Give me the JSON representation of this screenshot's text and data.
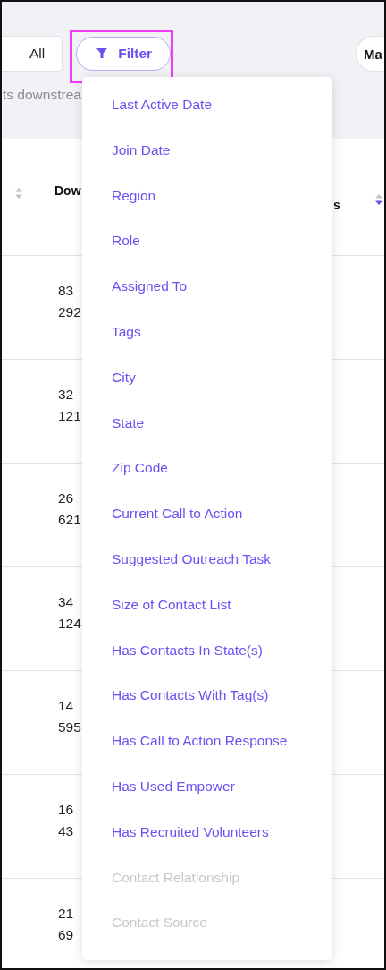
{
  "toolbar": {
    "segments": [
      {
        "label": "All"
      }
    ],
    "filter_button": {
      "label": "Filter",
      "highlighted": true
    },
    "right_button": {
      "label": "Ma"
    }
  },
  "subtitle": "ts downstrea",
  "table": {
    "columns": [
      {
        "sorted_descending": false
      },
      {
        "label": "Dow"
      },
      {
        "label": "s",
        "sorted_descending": true
      }
    ],
    "rows": [
      {
        "lines": [
          "83",
          "292"
        ]
      },
      {
        "lines": [
          "32",
          "121"
        ]
      },
      {
        "lines": [
          "26",
          "621"
        ]
      },
      {
        "lines": [
          "34",
          "124"
        ]
      },
      {
        "lines": [
          "14",
          "595"
        ]
      },
      {
        "lines": [
          "16",
          "43"
        ]
      },
      {
        "lines": [
          "21",
          "69"
        ]
      }
    ]
  },
  "filter_menu": {
    "items": [
      {
        "label": "Last Active Date",
        "disabled": false
      },
      {
        "label": "Join Date",
        "disabled": false
      },
      {
        "label": "Region",
        "disabled": false
      },
      {
        "label": "Role",
        "disabled": false
      },
      {
        "label": "Assigned To",
        "disabled": false
      },
      {
        "label": "Tags",
        "disabled": false
      },
      {
        "label": "City",
        "disabled": false
      },
      {
        "label": "State",
        "disabled": false
      },
      {
        "label": "Zip Code",
        "disabled": false
      },
      {
        "label": "Current Call to Action",
        "disabled": false
      },
      {
        "label": "Suggested Outreach Task",
        "disabled": false
      },
      {
        "label": "Size of Contact List",
        "disabled": false
      },
      {
        "label": "Has Contacts In State(s)",
        "disabled": false
      },
      {
        "label": "Has Contacts With Tag(s)",
        "disabled": false
      },
      {
        "label": "Has Call to Action Response",
        "disabled": false
      },
      {
        "label": "Has Used Empower",
        "disabled": false
      },
      {
        "label": "Has Recruited Volunteers",
        "disabled": false
      },
      {
        "label": "Contact Relationship",
        "disabled": true
      },
      {
        "label": "Contact Source",
        "disabled": true
      }
    ]
  }
}
